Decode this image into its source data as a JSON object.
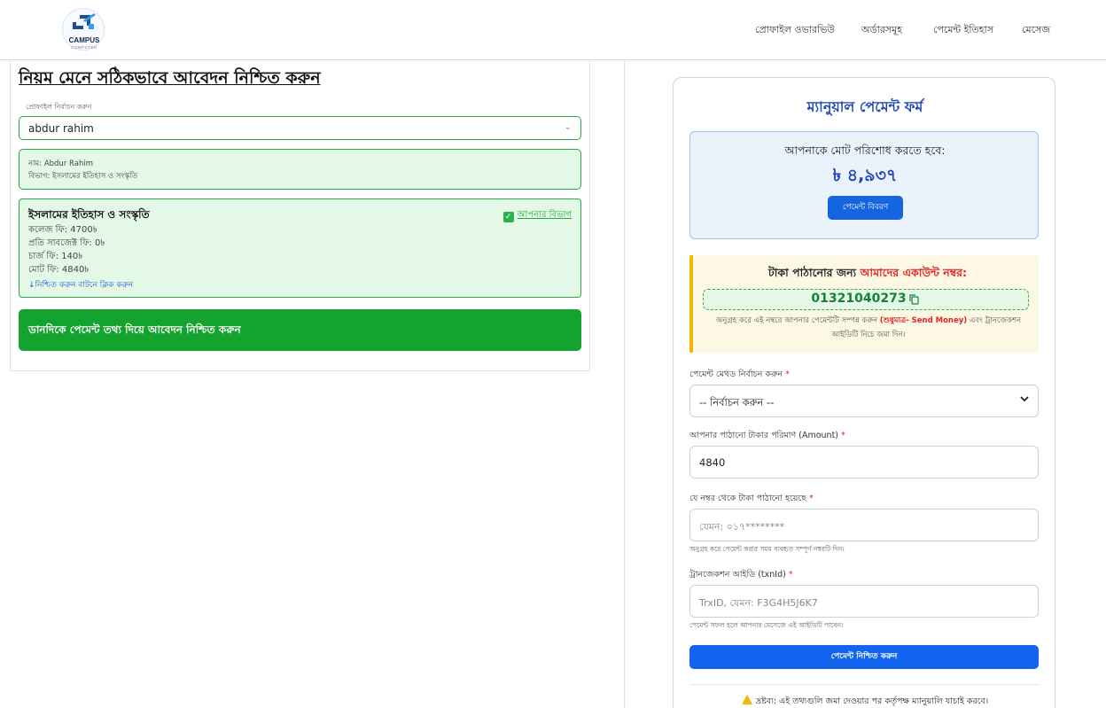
{
  "header": {
    "logo_text": "CAMPUS",
    "logo_subtext": "COMPUTER",
    "nav": [
      "প্রোফাইল ওভারভিউ",
      "অর্ডারসমূহ",
      "পেমেন্ট ইতিহাস",
      "মেসেজ"
    ]
  },
  "left": {
    "page_title": "নিয়ম মেনে সঠিকভাবে আবেদন নিশ্চিত করুন",
    "profile_select_label": "প্রোফাইল নির্বাচন করুন",
    "profile_selected": "abdur rahim",
    "profile_info": {
      "name_line": "নাম: Abdur Rahim",
      "dept_line": "বিভাগ: ইসলামের ইতিহাস ও সংস্কৃতি"
    },
    "department_card": {
      "title": "ইসলামের ইতিহাস ও সংস্কৃতি",
      "badge": "আপনার বিভাগ",
      "lines": [
        "কলেজ ফি: 4700৳",
        "প্রতি সাবজেক্ট ফি: 0৳",
        "চার্জ ফি: 140৳",
        "মোট ফি: 4840৳"
      ],
      "hint": "↓নিশ্চিত করুন বাটনে ক্লিক করুন"
    },
    "banner_text": "ডানদিকে পেমেন্ট তথ্য দিয়ে আবেদন নিশ্চিত করুন"
  },
  "form": {
    "title": "ম্যানুয়াল পেমেন্ট ফর্ম",
    "total_label": "আপনাকে মোট পরিশোধ করতে হবে:",
    "total_amount": "৳ ৪,৯৩৭",
    "details_button": "পেমেন্ট বিবরণ",
    "account": {
      "title_prefix": "টাকা পাঠানোর জন্য ",
      "title_highlight": "আমাদের একাউন্ট নম্বর:",
      "number": "01321040273",
      "note_prefix": "অনুগ্রহ করে এই নম্বরে আপনার পেমেন্টটি সম্পন্ন করুন ",
      "note_highlight": "(শুধুমাত্র- Send Money)",
      "note_suffix": " এবং ট্রানজেকশন আইডিটি নিচে জমা দিন।"
    },
    "method_label": "পেমেন্ট মেথড নির্বাচন করুন",
    "method_value": "-- নির্বাচন করুন --",
    "amount_label": "আপনার পাঠানো টাকার পরিমাণ (Amount)",
    "amount_value": "4840",
    "sender_label": "যে নম্বর থেকে টাকা পাঠানো হয়েছে",
    "sender_placeholder": "যেমন: ০১৭********",
    "sender_help": "অনুগ্রহ করে পেমেন্ট করার সময় ব্যবহৃত সম্পূর্ণ নম্বরটি দিন।",
    "txn_label": "ট্রানজেকশন আইডি (txnId)",
    "txn_placeholder": "TrxID, যেমন: F3G4H5J6K7",
    "txn_help": "পেমেন্ট সফল হলে আপনার মেসেজে এই আইডিটি পাবেন।",
    "required_mark": "*",
    "submit_button": "পেমেন্ট নিশ্চিত করুন",
    "warning": "দ্রষ্টব্য: এই তথ্যগুলি জমা দেওয়ার পর কর্তৃপক্ষ ম্যানুয়ালি যাচাই করবে।"
  },
  "colors": {
    "accent_blue": "#1565e0",
    "title_blue": "#1f47b6",
    "success_green": "#14a32e",
    "danger_red": "#e02424",
    "warning_yellow": "#f5b800"
  },
  "icons": {
    "logo": "campus-computer-logo",
    "select_caret": "chevron-down-icon",
    "badge_check": "checkbox-checked-icon",
    "copy": "copy-icon",
    "warning": "warning-icon"
  }
}
